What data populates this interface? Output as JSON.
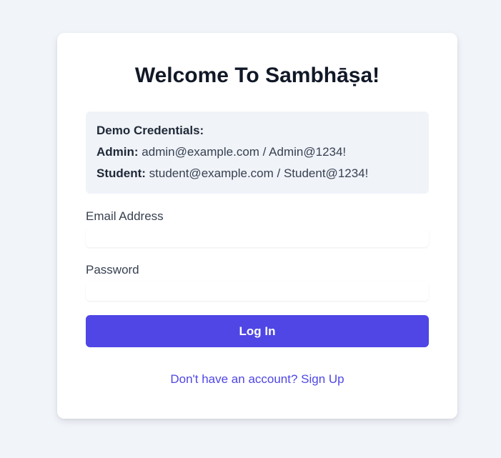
{
  "page": {
    "title": "Welcome To Sambhāṣa!"
  },
  "demo": {
    "heading": "Demo Credentials:",
    "admin_label": "Admin:",
    "admin_value": "admin@example.com / Admin@1234!",
    "student_label": "Student:",
    "student_value": "student@example.com / Student@1234!"
  },
  "form": {
    "email_label": "Email Address",
    "email_value": "",
    "email_placeholder": "",
    "password_label": "Password",
    "password_value": "",
    "password_placeholder": "",
    "submit_label": "Log In"
  },
  "footer": {
    "signup_text": "Don't have an account? Sign Up"
  },
  "colors": {
    "background": "#f1f4f9",
    "card": "#ffffff",
    "accent": "#4f46e5",
    "demo_box": "#f0f3f8",
    "title": "#111827"
  }
}
